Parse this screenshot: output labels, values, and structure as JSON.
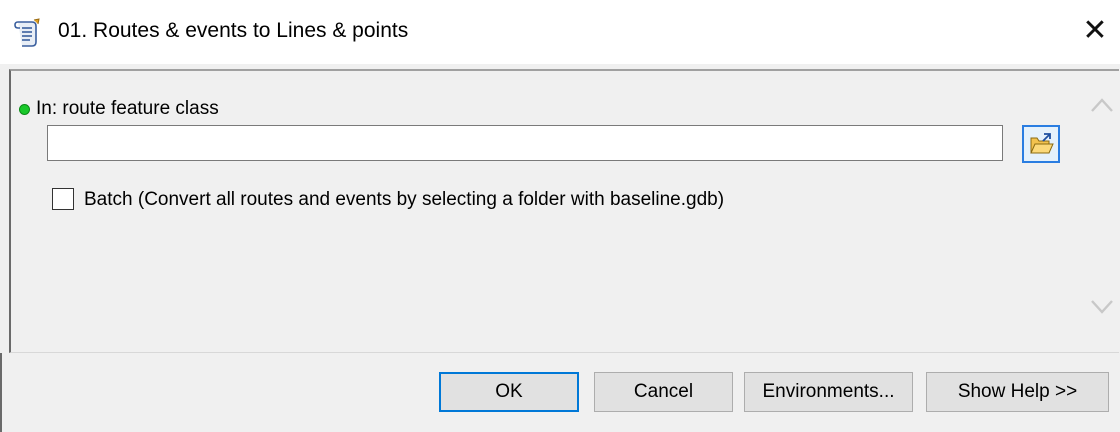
{
  "window": {
    "title": "01. Routes & events to Lines & points",
    "close_glyph": "✕",
    "icon": "script-scroll-icon"
  },
  "parameter": {
    "label": "In: route feature class",
    "required_indicator_color": "#19c82a",
    "value": "",
    "browse_icon": "open-folder-icon"
  },
  "batch": {
    "label": "Batch (Convert all routes and events by selecting a folder with baseline.gdb)",
    "checked": false
  },
  "buttons": {
    "ok": "OK",
    "cancel": "Cancel",
    "environments": "Environments...",
    "show_help": "Show Help >>"
  },
  "colors": {
    "accent": "#0078d7",
    "dialog_bg": "#f0f0f0"
  }
}
